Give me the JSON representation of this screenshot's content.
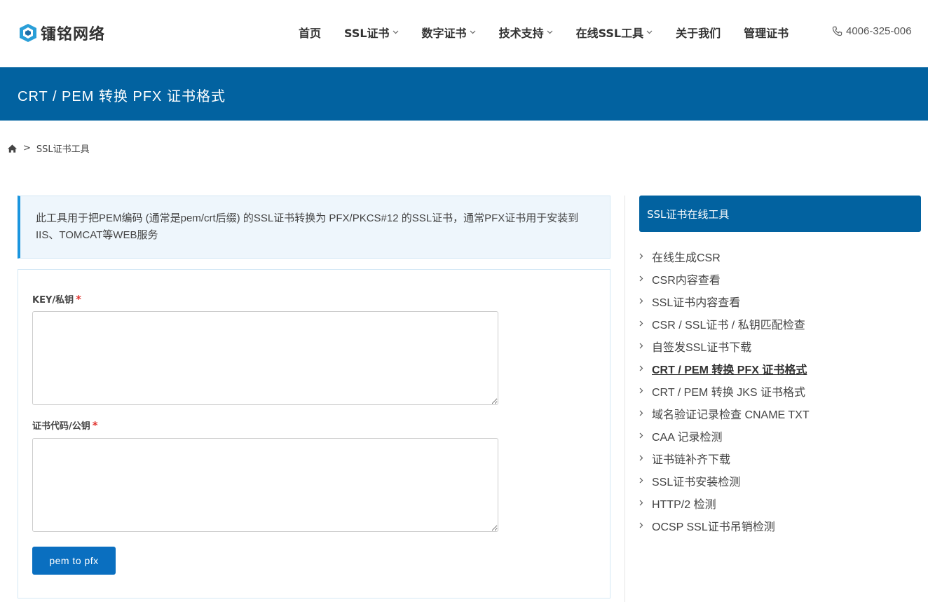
{
  "header": {
    "logo_text": "镭铭网络",
    "nav": [
      {
        "label": "首页",
        "dropdown": false
      },
      {
        "label": "SSL证书",
        "dropdown": true
      },
      {
        "label": "数字证书",
        "dropdown": true
      },
      {
        "label": "技术支持",
        "dropdown": true
      },
      {
        "label": "在线SSL工具",
        "dropdown": true
      },
      {
        "label": "关于我们",
        "dropdown": false
      },
      {
        "label": "管理证书",
        "dropdown": false
      }
    ],
    "phone": "4006-325-006"
  },
  "banner": {
    "title": "CRT / PEM 转换 PFX 证书格式"
  },
  "breadcrumb": {
    "separator": ">",
    "current": "SSL证书工具"
  },
  "info": {
    "text": "此工具用于把PEM编码 (通常是pem/crt后缀) 的SSL证书转换为 PFX/PKCS#12 的SSL证书，通常PFX证书用于安装到IIS、TOMCAT等WEB服务"
  },
  "form": {
    "key_label": "KEY/私钥",
    "key_value": "",
    "cert_label": "证书代码/公钥",
    "cert_value": "",
    "required_mark": "*",
    "submit_label": "pem to pfx"
  },
  "sidebar": {
    "title": "SSL证书在线工具",
    "active_index": 5,
    "items": [
      {
        "label": "在线生成CSR"
      },
      {
        "label": "CSR内容查看"
      },
      {
        "label": "SSL证书内容查看"
      },
      {
        "label": "CSR / SSL证书 / 私钥匹配检查"
      },
      {
        "label": "自签发SSL证书下载"
      },
      {
        "label": "CRT / PEM 转换 PFX 证书格式"
      },
      {
        "label": "CRT / PEM 转换 JKS 证书格式"
      },
      {
        "label": "域名验证记录检查 CNAME TXT"
      },
      {
        "label": "CAA 记录检测"
      },
      {
        "label": "证书链补齐下载"
      },
      {
        "label": "SSL证书安装检测"
      },
      {
        "label": "HTTP/2 检测"
      },
      {
        "label": "OCSP SSL证书吊销检测"
      }
    ]
  },
  "colors": {
    "primary": "#0262a0",
    "button": "#0a6fc0",
    "info_bg": "#eef6fc",
    "info_border": "#1a95de",
    "required": "#e0312c"
  }
}
